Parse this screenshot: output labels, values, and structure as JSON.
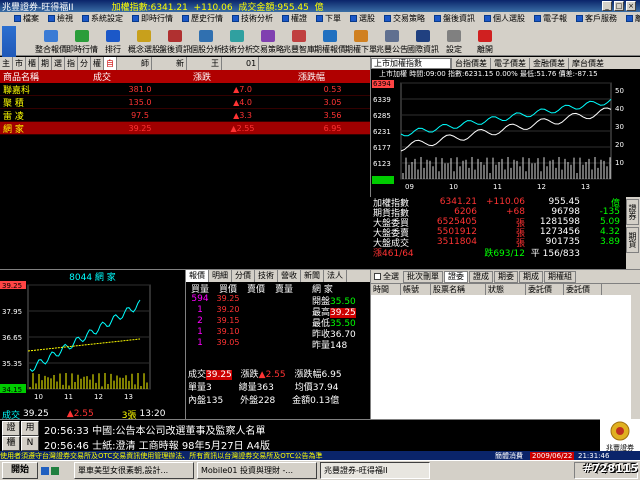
{
  "window": {
    "title": "兆豐證券-旺得福II",
    "index_label": "加權指數:6341.21",
    "index_change": "+110.06",
    "turnover": "成交金額:955.45",
    "unit": "億",
    "btn_min": "_",
    "btn_max": "□",
    "btn_close": "×"
  },
  "menu": [
    "檔案",
    "檢視",
    "系統設定",
    "即時行情",
    "歷史行情",
    "技術分析",
    "權證",
    "下單",
    "選股",
    "交易策略",
    "盤後資訊",
    "個人選股",
    "電子報",
    "客戶服務",
    "離開"
  ],
  "toolbar": [
    {
      "label": "整合報價",
      "color": "#3a7bd5"
    },
    {
      "label": "即時行情",
      "color": "#2a9d3a"
    },
    {
      "label": "排行",
      "color": "#1c58c8"
    },
    {
      "label": "概念選股",
      "color": "#c8a01c"
    },
    {
      "label": "盤後資訊",
      "color": "#b03030"
    },
    {
      "label": "個股分析",
      "color": "#3070b0"
    },
    {
      "label": "技術分析",
      "color": "#30a0a0"
    },
    {
      "label": "交易策略",
      "color": "#8040b0"
    },
    {
      "label": "兆豐智庫",
      "color": "#c04040"
    },
    {
      "label": "期權報價",
      "color": "#2070c0"
    },
    {
      "label": "期權下單",
      "color": "#d08020"
    },
    {
      "label": "兆豐公告",
      "color": "#607090"
    },
    {
      "label": "國際資訊",
      "color": "#204080"
    },
    {
      "label": "設定",
      "color": "#808080"
    },
    {
      "label": "離開",
      "color": "#d02020"
    }
  ],
  "side_logo": "Mega",
  "quote_tabs": [
    "主",
    "市",
    "櫃",
    "期",
    "選",
    "指",
    "分",
    "權",
    "自",
    "師",
    "新",
    "王",
    "01"
  ],
  "quote_table": {
    "headers": [
      "商品名稱",
      "成交",
      "漲跌",
      "漲跌幅"
    ],
    "rows": [
      {
        "name": "聯嘉科",
        "price": "381.0",
        "change": "▲7.0",
        "pct": "0.53"
      },
      {
        "name": "聚  積",
        "price": "135.0",
        "change": "▲4.0",
        "pct": "3.05"
      },
      {
        "name": "雷  凌",
        "price": "97.5",
        "change": "▲3.3",
        "pct": "3.56"
      },
      {
        "name": "網  家",
        "price": "39.25",
        "change": "▲2.55",
        "pct": "6.95"
      }
    ]
  },
  "index_panel": {
    "select": "上市加權指數",
    "tabs": [
      "台指價差",
      "電子價差",
      "金融價差",
      "摩台價差"
    ],
    "info": "上市加權 時間:09:00 指數:6231.15 0.00% 最低:51.76 價差:-87.15",
    "y_labels": [
      "6394",
      "6339",
      "6285",
      "6231",
      "6177",
      "6123",
      "6069"
    ],
    "x_labels": [
      "09",
      "10",
      "11",
      "12",
      "13"
    ],
    "right_labels": [
      "50",
      "40",
      "30",
      "20",
      "10"
    ]
  },
  "market_summary": [
    {
      "a": "加權指數",
      "b": "6341.21",
      "c": "+110.06",
      "d": "955.45",
      "e": "億"
    },
    {
      "a": "期貨指數",
      "b": "6206",
      "c": "+68",
      "d": "96798",
      "e": "-135"
    },
    {
      "a": "大盤委買",
      "b": "6525405",
      "c": "張",
      "d": "1281598",
      "e": "5.09"
    },
    {
      "a": "大盤委賣",
      "b": "5501912",
      "c": "張",
      "d": "1273456",
      "e": "4.32"
    },
    {
      "a": "大盤成交",
      "b": "3511804",
      "c": "張",
      "d": "901735",
      "e": "3.89"
    },
    {
      "a": "漲461/64",
      "b": "",
      "c": "跌693/12",
      "d": "平 156/833",
      "e": ""
    }
  ],
  "market_side_tabs": [
    "證券",
    "期貨"
  ],
  "stock": {
    "header": "8044 網  家",
    "y_labels": [
      "39.25",
      "37.95",
      "36.65",
      "35.35",
      "34.15"
    ],
    "x_labels": [
      "10",
      "11",
      "12",
      "13"
    ],
    "footer_label": "成交",
    "footer_price": "39.25",
    "footer_change": "▲2.55",
    "footer_vol": "3張",
    "footer_time": "13:20"
  },
  "detail": {
    "tabs": [
      "報價",
      "明細",
      "分價",
      "技術",
      "營收",
      "新聞",
      "法人"
    ],
    "headers": [
      "買量",
      "買價",
      "賣價",
      "賣量"
    ],
    "rows": [
      {
        "bq": "594",
        "bp": "39.25",
        "ap": "",
        "aq": ""
      },
      {
        "bq": "1",
        "bp": "39.20",
        "ap": "",
        "aq": ""
      },
      {
        "bq": "2",
        "bp": "39.15",
        "ap": "",
        "aq": ""
      },
      {
        "bq": "1",
        "bp": "39.10",
        "ap": "",
        "aq": ""
      },
      {
        "bq": "1",
        "bp": "39.05",
        "ap": "",
        "aq": ""
      }
    ],
    "stock_name": "網  家",
    "stats": [
      {
        "k": "開盤",
        "v": "35.50",
        "cls": "g"
      },
      {
        "k": "最高",
        "v": "39.25",
        "cls": ""
      },
      {
        "k": "最低",
        "v": "35.50",
        "cls": "g"
      },
      {
        "k": "昨收",
        "v": "36.70",
        "cls": "w"
      },
      {
        "k": "昨量",
        "v": "148",
        "cls": "w"
      }
    ],
    "deal_label": "成交",
    "deal_price": "39.25",
    "chg_label": "漲跌",
    "chg_value": "▲2.55",
    "pct_label": "漲跌幅",
    "pct_value": "6.95",
    "single_label": "單量",
    "single_value": "3",
    "total_label": "總量",
    "total_value": "363",
    "avg_label": "均價",
    "avg_value": "37.94",
    "inner_label": "內盤",
    "inner_value": "135",
    "outer_label": "外盤",
    "outer_value": "228",
    "amt_label": "金額",
    "amt_value": "0.13億"
  },
  "news": {
    "checkbox_label": "全選",
    "tabs": [
      "批次刪單",
      "證委",
      "證成",
      "期委",
      "期成",
      "期權組"
    ],
    "headers": [
      "時間",
      "帳號",
      "股票名稱",
      "狀態",
      "委託價",
      "委託價"
    ]
  },
  "ticker": {
    "btn_detail": "證",
    "btn_use": "用",
    "btn_stock": "櫃",
    "btn_n": "N",
    "line1": "20:56:33 中國:公告本公司改選董事及監察人名單",
    "line2": "20:56:46 士紙:澄清 工商時報 98年5月27日 A4版"
  },
  "logo_text": "兆豐證券",
  "status": {
    "text": "使用者須遵守台灣證券交易所及OTC交易資訊使用管理辦法、所有資訊以台灣證券交易所及OTC公告為準",
    "region": "簡體消費",
    "date": "2009/06/22",
    "time": "21:31:46"
  },
  "taskbar": {
    "start": "開始",
    "items": [
      "單車美型女很素朝,設計...",
      "Mobile01 投資與理財 -...",
      "兆豐證券-旺得福II"
    ],
    "tray_time": "下午 09:31"
  },
  "watermark": "#728115"
}
